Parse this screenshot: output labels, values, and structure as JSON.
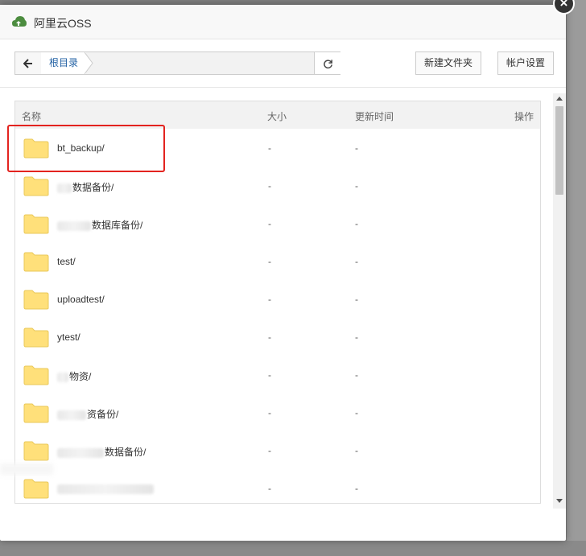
{
  "dialog": {
    "title": "阿里云OSS",
    "close_label": "×",
    "icon": "aliyun-cloud-icon"
  },
  "pathbar": {
    "back_icon": "arrow-left-icon",
    "root_label": "根目录",
    "refresh_icon": "refresh-icon"
  },
  "toolbar": {
    "new_folder_label": "新建文件夹",
    "account_settings_label": "帐户设置"
  },
  "table": {
    "headers": {
      "name": "名称",
      "size": "大小",
      "updated": "更新时间",
      "actions": "操作"
    },
    "rows": [
      {
        "name": "bt_backup/",
        "size": "-",
        "updated": "-"
      },
      {
        "name": "数据备份/",
        "size": "-",
        "updated": "-"
      },
      {
        "name": "数据库备份/",
        "size": "-",
        "updated": "-"
      },
      {
        "name": "test/",
        "size": "-",
        "updated": "-"
      },
      {
        "name": "uploadtest/",
        "size": "-",
        "updated": "-"
      },
      {
        "name": "ytest/",
        "size": "-",
        "updated": "-"
      },
      {
        "name": "物资/",
        "size": "-",
        "updated": "-"
      },
      {
        "name": "资备份/",
        "size": "-",
        "updated": "-"
      },
      {
        "name": "数据备份/",
        "size": "-",
        "updated": "-"
      },
      {
        "name": "",
        "size": "-",
        "updated": "-"
      }
    ]
  },
  "colors": {
    "highlight_box": "#e3231f",
    "folder": "#ffe07a",
    "link": "#1f5fa3"
  }
}
